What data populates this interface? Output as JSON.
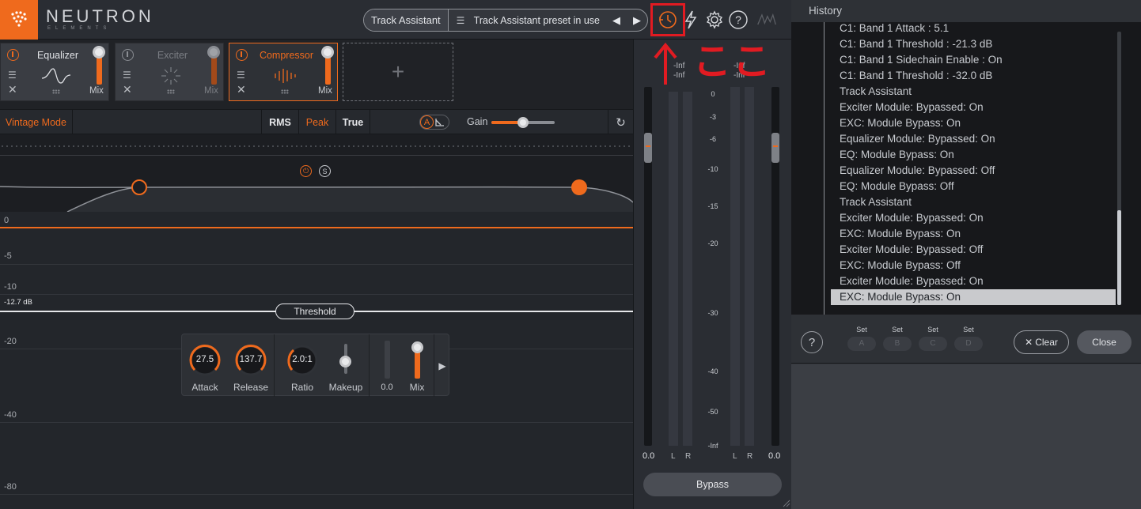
{
  "header": {
    "brand": "NEUTRON",
    "brand_sub": "ELEMENTS",
    "track_assistant_label": "Track Assistant",
    "preset_label": "Track Assistant preset in use",
    "accent": "#ef6a1d",
    "icons": [
      "history-icon",
      "lightning-icon",
      "gear-icon",
      "help-icon",
      "wave-icon"
    ]
  },
  "modules": [
    {
      "name": "Equalizer",
      "mix_label": "Mix",
      "enabled": true
    },
    {
      "name": "Exciter",
      "mix_label": "Mix",
      "enabled": false
    },
    {
      "name": "Compressor",
      "mix_label": "Mix",
      "enabled": true,
      "active": true
    }
  ],
  "toolbar": {
    "vintage_mode": "Vintage Mode",
    "rms": "RMS",
    "peak": "Peak",
    "true": "True",
    "ab": "A",
    "gain_label": "Gain",
    "gain_level": 0.5
  },
  "graph": {
    "scale": [
      "0",
      "-5",
      "-10",
      "-20",
      "-40",
      "-80"
    ],
    "threshold_value": "-12.7 dB",
    "threshold_label": "Threshold",
    "sidechain_power": "⏻",
    "sidechain_solo": "S"
  },
  "controls": {
    "attack": {
      "value": "27.5",
      "label": "Attack"
    },
    "release": {
      "value": "137.7",
      "label": "Release"
    },
    "ratio": {
      "value": "2.0:1",
      "label": "Ratio"
    },
    "makeup": {
      "label": "Makeup"
    },
    "gr_value": "0.0",
    "mix": {
      "label": "Mix"
    }
  },
  "meter": {
    "inf_left": "-Inf",
    "inf_left2": "-Inf",
    "inf_right": "-Inf",
    "inf_right2": "-Inf",
    "scale": [
      "0",
      "-3",
      "-6",
      "-10",
      "-15",
      "-20",
      "-30",
      "-40",
      "-50",
      "-Inf"
    ],
    "L": "L",
    "R": "R",
    "in_value": "0.0",
    "out_value": "0.0",
    "bypass_label": "Bypass"
  },
  "annotation": {
    "koko": "ここ",
    "color": "#e11b22"
  },
  "history": {
    "title": "History",
    "items": [
      "C1: Band 1 Attack : 5.1",
      "C1: Band 1 Threshold : -21.3 dB",
      "C1: Band 1 Sidechain Enable : On",
      "C1: Band 1 Threshold : -32.0 dB",
      "Track Assistant",
      "Exciter Module: Bypassed: On",
      "EXC: Module Bypass: On",
      "Equalizer Module: Bypassed: On",
      "EQ: Module Bypass: On",
      "Equalizer Module: Bypassed: Off",
      "EQ: Module Bypass: Off",
      "Track Assistant",
      "Exciter Module: Bypassed: On",
      "EXC: Module Bypass: On",
      "Exciter Module: Bypassed: Off",
      "EXC: Module Bypass: Off",
      "Exciter Module: Bypassed: On",
      "EXC: Module Bypass: On"
    ],
    "selected_index": 17,
    "help": "?",
    "set_label": "Set",
    "sets": [
      "A",
      "B",
      "C",
      "D"
    ],
    "clear_label": "Clear",
    "clear_icon": "✕",
    "close_label": "Close"
  }
}
